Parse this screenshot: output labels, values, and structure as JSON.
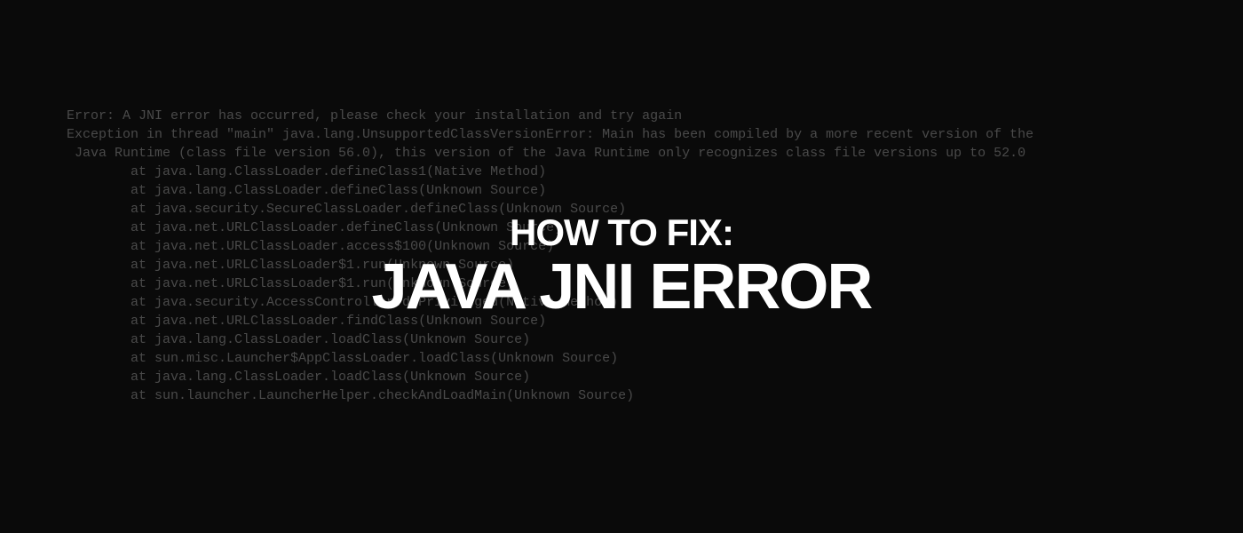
{
  "terminal": {
    "lines": [
      "Error: A JNI error has occurred, please check your installation and try again",
      "Exception in thread \"main\" java.lang.UnsupportedClassVersionError: Main has been compiled by a more recent version of the",
      " Java Runtime (class file version 56.0), this version of the Java Runtime only recognizes class file versions up to 52.0",
      "        at java.lang.ClassLoader.defineClass1(Native Method)",
      "        at java.lang.ClassLoader.defineClass(Unknown Source)",
      "        at java.security.SecureClassLoader.defineClass(Unknown Source)",
      "        at java.net.URLClassLoader.defineClass(Unknown Source)",
      "        at java.net.URLClassLoader.access$100(Unknown Source)",
      "        at java.net.URLClassLoader$1.run(Unknown Source)",
      "        at java.net.URLClassLoader$1.run(Unknown Source)",
      "        at java.security.AccessController.doPrivileged(Native Method)",
      "        at java.net.URLClassLoader.findClass(Unknown Source)",
      "        at java.lang.ClassLoader.loadClass(Unknown Source)",
      "        at sun.misc.Launcher$AppClassLoader.loadClass(Unknown Source)",
      "        at java.lang.ClassLoader.loadClass(Unknown Source)",
      "        at sun.launcher.LauncherHelper.checkAndLoadMain(Unknown Source)"
    ]
  },
  "overlay": {
    "line1": "HOW TO FIX:",
    "line2": "JAVA JNI ERROR"
  }
}
